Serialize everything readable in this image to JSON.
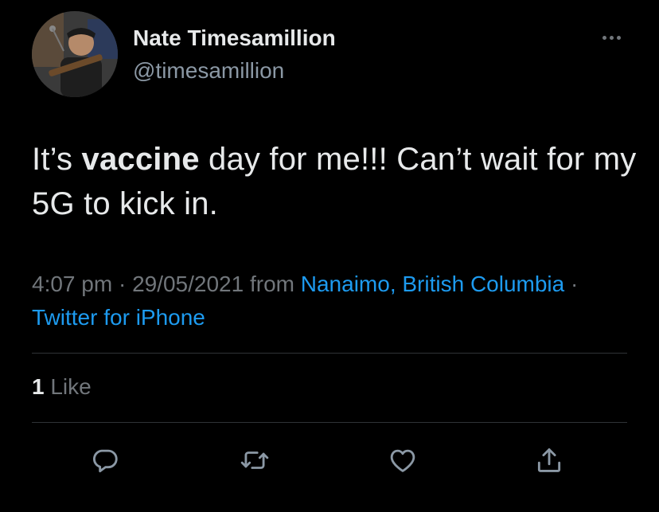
{
  "user": {
    "display_name": "Nate Timesamillion",
    "handle": "@timesamillion"
  },
  "tweet": {
    "text_before": "It’s ",
    "text_bold": "vaccine",
    "text_after": " day for me!!! Can’t wait for my 5G to kick in."
  },
  "meta": {
    "time": "4:07 pm",
    "sep1": " · ",
    "date": "29/05/2021",
    "from_word": " from ",
    "location": "Nanaimo, British Columbia",
    "sep2": " · ",
    "source": "Twitter for iPhone"
  },
  "stats": {
    "likes_count": "1",
    "likes_label": " Like"
  },
  "actions": {
    "reply_icon": "reply-icon",
    "retweet_icon": "retweet-icon",
    "like_icon": "heart-icon",
    "share_icon": "share-icon"
  },
  "colors": {
    "background": "#000000",
    "primary_text": "#e7e9ea",
    "secondary_text": "#71767b",
    "link": "#1d9bf0",
    "divider": "#2f3336"
  }
}
